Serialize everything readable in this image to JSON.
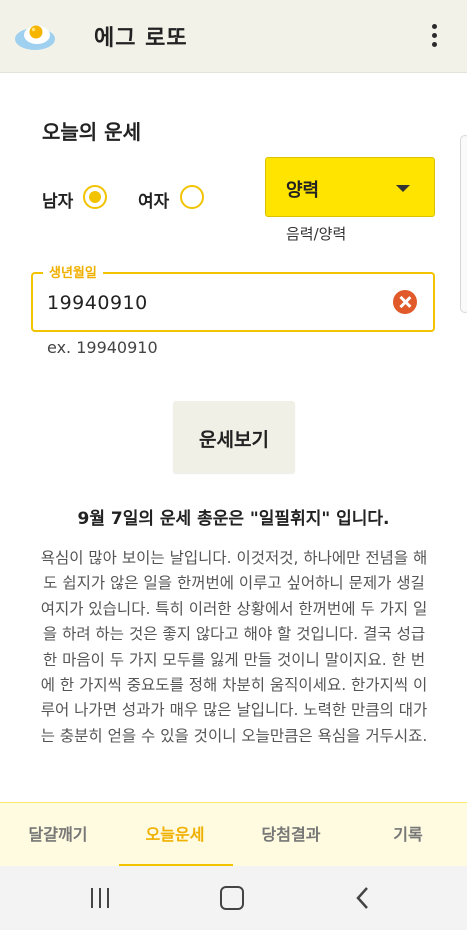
{
  "header": {
    "title": "에그 로또",
    "logo_icon": "egg-logo-icon",
    "menu_icon": "more-vertical-icon"
  },
  "main": {
    "section_title": "오늘의 운세",
    "gender": {
      "options": [
        {
          "label": "남자",
          "selected": true
        },
        {
          "label": "여자",
          "selected": false
        }
      ]
    },
    "calendar_select": {
      "value": "양력",
      "helper": "음력/양력"
    },
    "birth_field": {
      "label": "생년월일",
      "value": "19940910",
      "helper": "ex. 19940910"
    },
    "fortune_button": "운세보기",
    "result": {
      "title": "9월 7일의 운세 총운은 \"일필휘지\" 입니다.",
      "text": "욕심이 많아 보이는 날입니다. 이것저것, 하나에만 전념을 해도 쉽지가 않은 일을 한꺼번에 이루고 싶어하니 문제가 생길 여지가 있습니다. 특히 이러한 상황에서 한꺼번에 두 가지 일을 하려 하는 것은 좋지 않다고 해야 할 것입니다. 결국 성급한 마음이 두 가지 모두를 잃게 만들 것이니 말이지요. 한 번에 한 가지씩 중요도를 정해 차분히 움직이세요. 한가지씩 이루어 나가면 성과가 매우 많은 날입니다. 노력한 만큼의 대가는 충분히 얻을 수 있을 것이니 오늘만큼은 욕심을 거두시죠."
    }
  },
  "tabs": [
    {
      "label": "달걀깨기",
      "active": false
    },
    {
      "label": "오늘운세",
      "active": true
    },
    {
      "label": "당첨결과",
      "active": false
    },
    {
      "label": "기록",
      "active": false
    }
  ],
  "system_nav": {
    "recent": "recent-apps-icon",
    "home": "home-icon",
    "back": "back-icon"
  },
  "colors": {
    "accent": "#f2c300",
    "select_bg": "#ffe400",
    "clear": "#e05a2a",
    "appbar": "#f2f2e9"
  }
}
